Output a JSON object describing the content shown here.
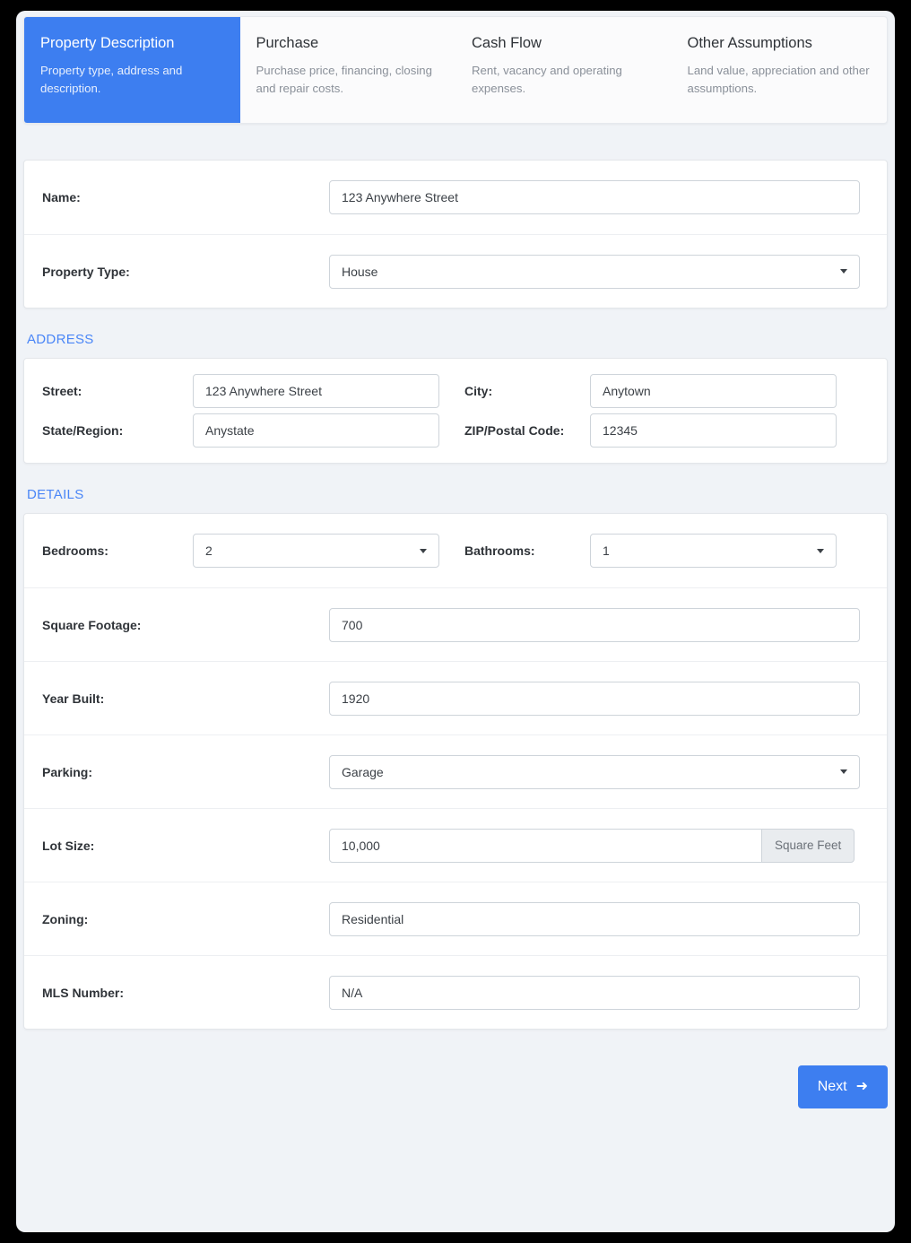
{
  "tabs": [
    {
      "title": "Property Description",
      "desc": "Property type, address and description.",
      "active": true
    },
    {
      "title": "Purchase",
      "desc": "Purchase price, financing, closing and repair costs.",
      "active": false
    },
    {
      "title": "Cash Flow",
      "desc": "Rent, vacancy and operating expenses.",
      "active": false
    },
    {
      "title": "Other Assumptions",
      "desc": "Land value, appreciation and other assumptions.",
      "active": false
    }
  ],
  "general": {
    "name_label": "Name:",
    "name_value": "123 Anywhere Street",
    "property_type_label": "Property Type:",
    "property_type_value": "House"
  },
  "address": {
    "heading": "ADDRESS",
    "street_label": "Street:",
    "street_value": "123 Anywhere Street",
    "city_label": "City:",
    "city_value": "Anytown",
    "state_label": "State/Region:",
    "state_value": "Anystate",
    "zip_label": "ZIP/Postal Code:",
    "zip_value": "12345"
  },
  "details": {
    "heading": "DETAILS",
    "bedrooms_label": "Bedrooms:",
    "bedrooms_value": "2",
    "bathrooms_label": "Bathrooms:",
    "bathrooms_value": "1",
    "square_footage_label": "Square Footage:",
    "square_footage_value": "700",
    "year_built_label": "Year Built:",
    "year_built_value": "1920",
    "parking_label": "Parking:",
    "parking_value": "Garage",
    "lot_size_label": "Lot Size:",
    "lot_size_value": "10,000",
    "lot_size_unit": "Square Feet",
    "zoning_label": "Zoning:",
    "zoning_value": "Residential",
    "mls_label": "MLS Number:",
    "mls_value": "N/A"
  },
  "footer": {
    "next_label": "Next",
    "next_arrow": "➜"
  },
  "colors": {
    "accent": "#3d7ef0",
    "heading": "#4a86f7",
    "page_bg": "#f0f3f7",
    "addon_bg": "#e9ecef"
  }
}
